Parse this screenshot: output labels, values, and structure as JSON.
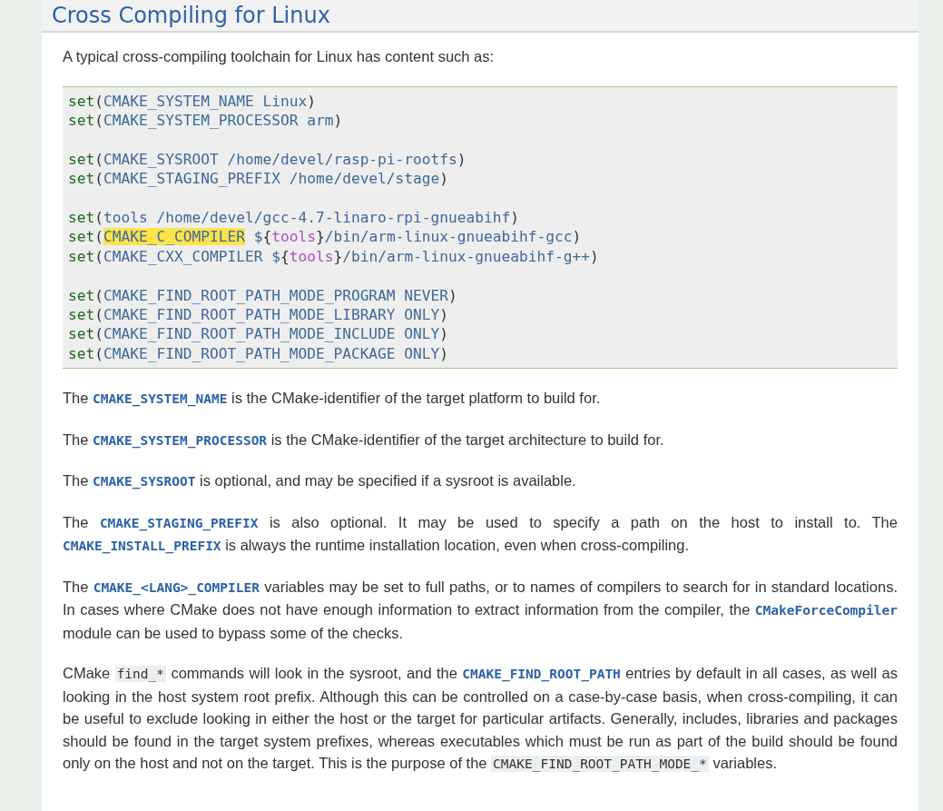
{
  "heading": "Cross Compiling for Linux",
  "intro": "A typical cross-compiling toolchain for Linux has content such as:",
  "code_groups": [
    [
      [
        {
          "kind": "keyword",
          "text": "set"
        },
        {
          "kind": "punct",
          "text": "("
        },
        {
          "kind": "arg",
          "text": "CMAKE_SYSTEM_NAME Linux"
        },
        {
          "kind": "punct",
          "text": ")"
        }
      ],
      [
        {
          "kind": "keyword",
          "text": "set"
        },
        {
          "kind": "punct",
          "text": "("
        },
        {
          "kind": "arg",
          "text": "CMAKE_SYSTEM_PROCESSOR arm"
        },
        {
          "kind": "punct",
          "text": ")"
        }
      ]
    ],
    [
      [
        {
          "kind": "keyword",
          "text": "set"
        },
        {
          "kind": "punct",
          "text": "("
        },
        {
          "kind": "arg",
          "text": "CMAKE_SYSROOT /home/devel/rasp-pi-rootfs"
        },
        {
          "kind": "punct",
          "text": ")"
        }
      ],
      [
        {
          "kind": "keyword",
          "text": "set"
        },
        {
          "kind": "punct",
          "text": "("
        },
        {
          "kind": "arg",
          "text": "CMAKE_STAGING_PREFIX /home/devel/stage"
        },
        {
          "kind": "punct",
          "text": ")"
        }
      ]
    ],
    [
      [
        {
          "kind": "keyword",
          "text": "set"
        },
        {
          "kind": "punct",
          "text": "("
        },
        {
          "kind": "arg",
          "text": "tools /home/devel/gcc-4.7-linaro-rpi-gnueabihf"
        },
        {
          "kind": "punct",
          "text": ")"
        }
      ],
      [
        {
          "kind": "keyword",
          "text": "set"
        },
        {
          "kind": "punct",
          "text": "("
        },
        {
          "kind": "highlight",
          "text": "CMAKE_C_COMPILER"
        },
        {
          "kind": "arg",
          "text": " $"
        },
        {
          "kind": "punct",
          "text": "{"
        },
        {
          "kind": "variable",
          "text": "tools"
        },
        {
          "kind": "punct",
          "text": "}"
        },
        {
          "kind": "arg",
          "text": "/bin/arm-linux-gnueabihf-gcc"
        },
        {
          "kind": "punct",
          "text": ")"
        }
      ],
      [
        {
          "kind": "keyword",
          "text": "set"
        },
        {
          "kind": "punct",
          "text": "("
        },
        {
          "kind": "arg",
          "text": "CMAKE_CXX_COMPILER $"
        },
        {
          "kind": "punct",
          "text": "{"
        },
        {
          "kind": "variable",
          "text": "tools"
        },
        {
          "kind": "punct",
          "text": "}"
        },
        {
          "kind": "arg",
          "text": "/bin/arm-linux-gnueabihf-g++"
        },
        {
          "kind": "punct",
          "text": ")"
        }
      ]
    ],
    [
      [
        {
          "kind": "keyword",
          "text": "set"
        },
        {
          "kind": "punct",
          "text": "("
        },
        {
          "kind": "arg",
          "text": "CMAKE_FIND_ROOT_PATH_MODE_PROGRAM NEVER"
        },
        {
          "kind": "punct",
          "text": ")"
        }
      ],
      [
        {
          "kind": "keyword",
          "text": "set"
        },
        {
          "kind": "punct",
          "text": "("
        },
        {
          "kind": "arg",
          "text": "CMAKE_FIND_ROOT_PATH_MODE_LIBRARY ONLY"
        },
        {
          "kind": "punct",
          "text": ")"
        }
      ],
      [
        {
          "kind": "keyword",
          "text": "set"
        },
        {
          "kind": "punct",
          "text": "("
        },
        {
          "kind": "arg",
          "text": "CMAKE_FIND_ROOT_PATH_MODE_INCLUDE ONLY"
        },
        {
          "kind": "punct",
          "text": ")"
        }
      ],
      [
        {
          "kind": "keyword",
          "text": "set"
        },
        {
          "kind": "punct",
          "text": "("
        },
        {
          "kind": "arg",
          "text": "CMAKE_FIND_ROOT_PATH_MODE_PACKAGE ONLY"
        },
        {
          "kind": "punct",
          "text": ")"
        }
      ]
    ]
  ],
  "paragraphs": [
    [
      {
        "kind": "text",
        "text": "The "
      },
      {
        "kind": "ref",
        "text": "CMAKE_SYSTEM_NAME"
      },
      {
        "kind": "text",
        "text": " is the CMake-identifier of the target platform to build for."
      }
    ],
    [
      {
        "kind": "text",
        "text": "The "
      },
      {
        "kind": "ref",
        "text": "CMAKE_SYSTEM_PROCESSOR"
      },
      {
        "kind": "text",
        "text": " is the CMake-identifier of the target architecture to build for."
      }
    ],
    [
      {
        "kind": "text",
        "text": "The "
      },
      {
        "kind": "ref",
        "text": "CMAKE_SYSROOT"
      },
      {
        "kind": "text",
        "text": " is optional, and may be specified if a sysroot is available."
      }
    ],
    [
      {
        "kind": "text",
        "text": "The "
      },
      {
        "kind": "ref",
        "text": "CMAKE_STAGING_PREFIX"
      },
      {
        "kind": "text",
        "text": " is also optional. It may be used to specify a path on the host to install to. The "
      },
      {
        "kind": "ref",
        "text": "CMAKE_INSTALL_PREFIX"
      },
      {
        "kind": "text",
        "text": " is always the runtime installation location, even when cross-compiling."
      }
    ],
    [
      {
        "kind": "text",
        "text": "The "
      },
      {
        "kind": "ref",
        "text": "CMAKE_<LANG>_COMPILER"
      },
      {
        "kind": "text",
        "text": " variables may be set to full paths, or to names of compilers to search for in standard locations. In cases where CMake does not have enough information to extract information from the compiler, the "
      },
      {
        "kind": "ref",
        "text": "CMakeForceCompiler"
      },
      {
        "kind": "text",
        "text": " module can be used to bypass some of the checks."
      }
    ],
    [
      {
        "kind": "text",
        "text": "CMake "
      },
      {
        "kind": "literal",
        "text": "find_*"
      },
      {
        "kind": "text",
        "text": " commands will look in the sysroot, and the "
      },
      {
        "kind": "ref",
        "text": "CMAKE_FIND_ROOT_PATH"
      },
      {
        "kind": "text",
        "text": " entries by default in all cases, as well as looking in the host system root prefix. Although this can be controlled on a case-by-case basis, when cross-compiling, it can be useful to exclude looking in either the host or the target for particular artifacts. Generally, includes, libraries and packages should be found in the target system prefixes, whereas executables which must be run as part of the build should be found only on the host and not on the target. This is the purpose of the "
      },
      {
        "kind": "literal",
        "text": "CMAKE_FIND_ROOT_PATH_MODE_*"
      },
      {
        "kind": "text",
        "text": " variables."
      }
    ]
  ]
}
